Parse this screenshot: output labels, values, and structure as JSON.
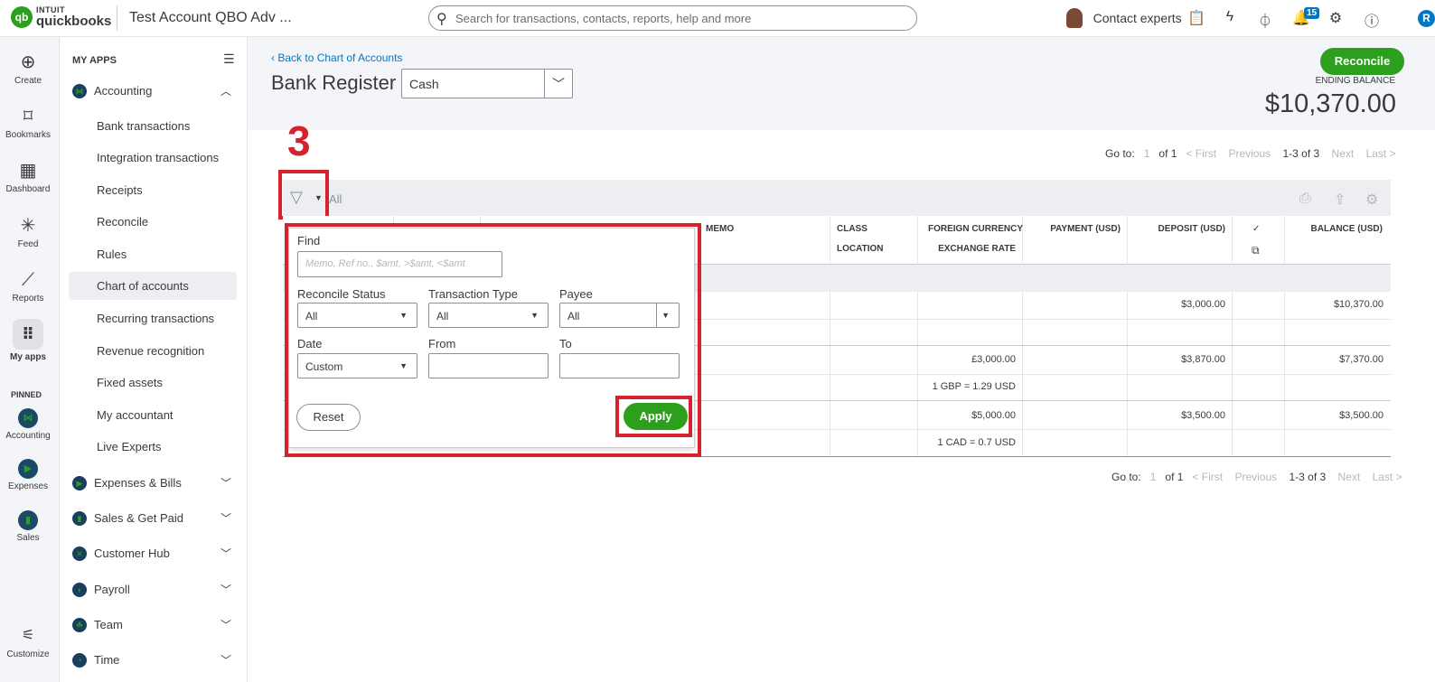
{
  "topbar": {
    "logo_glyph": "qb",
    "brand_top": "INTUIT",
    "brand_bottom": "quickbooks",
    "company": "Test Account QBO Adv ...",
    "search_placeholder": "Search for transactions, contacts, reports, help and more",
    "contact_label": "Contact experts",
    "notifications_count": "15",
    "user_initial": "R",
    "icons": [
      "search-icon",
      "clipboard-icon",
      "lightning-icon",
      "plug-icon",
      "bell-icon",
      "gear-icon",
      "help-icon"
    ]
  },
  "rail": {
    "items": [
      {
        "label": "Create",
        "glyph": "⊕"
      },
      {
        "label": "Bookmarks",
        "glyph": "⌑"
      },
      {
        "label": "Dashboard",
        "glyph": "▦"
      },
      {
        "label": "Feed",
        "glyph": "✳"
      },
      {
        "label": "Reports",
        "glyph": "⟋"
      },
      {
        "label": "My apps",
        "glyph": "⠿"
      }
    ],
    "pinned_header": "PINNED",
    "pinned": [
      {
        "label": "Accounting",
        "glyph": "⋈"
      },
      {
        "label": "Expenses",
        "glyph": "▶"
      },
      {
        "label": "Sales",
        "glyph": "▮"
      }
    ],
    "customize": "Customize"
  },
  "apps": {
    "header": "MY APPS",
    "accounting": "Accounting",
    "sub_items": [
      "Bank transactions",
      "Integration transactions",
      "Receipts",
      "Reconcile",
      "Rules",
      "Chart of accounts",
      "Recurring transactions",
      "Revenue recognition",
      "Fixed assets",
      "My accountant",
      "Live Experts"
    ],
    "active_sub": "Chart of accounts",
    "sections": [
      "Expenses & Bills",
      "Sales & Get Paid",
      "Customer Hub",
      "Payroll",
      "Team",
      "Time"
    ]
  },
  "header": {
    "back_link": "Back to Chart of Accounts",
    "title": "Bank Register",
    "account": "Cash",
    "reconcile_label": "Reconcile",
    "ending_balance_label": "ENDING BALANCE",
    "ending_balance": "$10,370.00"
  },
  "paging": {
    "goto": "Go to:",
    "page": "1",
    "of": "of 1",
    "first": "< First",
    "previous": "Previous",
    "range": "1-3 of 3",
    "next": "Next",
    "last": "Last >"
  },
  "annotation": {
    "step_number": "3"
  },
  "toolbar": {
    "filter_value": "All"
  },
  "table": {
    "headers": {
      "memo": "MEMO",
      "class": "CLASS",
      "location": "LOCATION",
      "fx1": "FOREIGN CURRENCY",
      "fx2": "EXCHANGE RATE",
      "payment": "PAYMENT (USD)",
      "deposit": "DEPOSIT (USD)",
      "check": "✓",
      "balance": "BALANCE (USD)"
    },
    "rows": [
      {
        "fx": "",
        "rate": "",
        "deposit": "$3,000.00",
        "balance": "$10,370.00"
      },
      {
        "fx": "£3,000.00",
        "rate": "1 GBP = 1.29 USD",
        "deposit": "$3,870.00",
        "balance": "$7,370.00"
      },
      {
        "fx": "$5,000.00",
        "rate": "1 CAD = 0.7 USD",
        "deposit": "$3,500.00",
        "balance": "$3,500.00"
      }
    ]
  },
  "filter": {
    "find_label": "Find",
    "find_placeholder": "Memo, Ref no., $amt, >$amt, <$amt",
    "reconcile_status_label": "Reconcile Status",
    "reconcile_status_value": "All",
    "transaction_type_label": "Transaction Type",
    "transaction_type_value": "All",
    "payee_label": "Payee",
    "payee_value": "All",
    "date_label": "Date",
    "date_value": "Custom",
    "from_label": "From",
    "to_label": "To",
    "reset_label": "Reset",
    "apply_label": "Apply"
  },
  "colors": {
    "brand_green": "#2ca01c",
    "link_blue": "#0077c5",
    "annotation_red": "#d5232d"
  }
}
